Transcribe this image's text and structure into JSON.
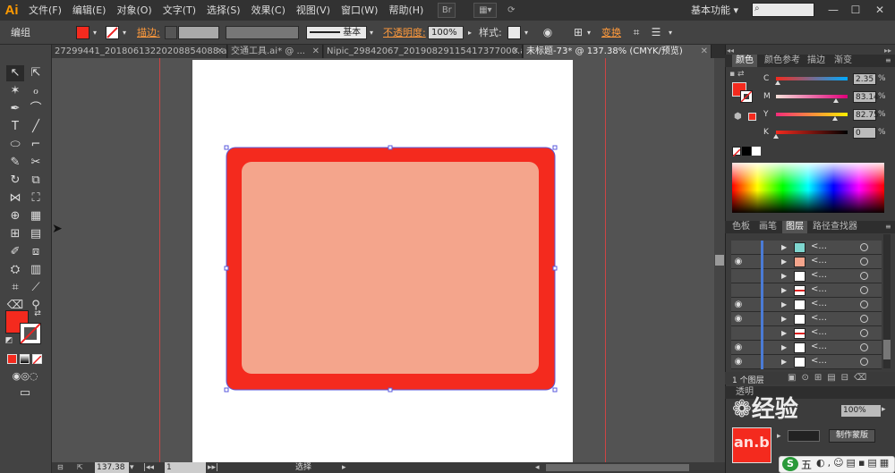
{
  "app": {
    "logo": "Ai"
  },
  "menu": [
    "文件(F)",
    "编辑(E)",
    "对象(O)",
    "文字(T)",
    "选择(S)",
    "效果(C)",
    "视图(V)",
    "窗口(W)",
    "帮助(H)"
  ],
  "header": {
    "workspace": "基本功能",
    "workspace_arrow": "▾",
    "window_min": "—",
    "window_max": "☐",
    "window_close": "✕"
  },
  "control": {
    "mode": "编组",
    "stroke_label": "描边:",
    "stroke_style": "基本",
    "opacity_label": "不透明度:",
    "opacity_value": "100%",
    "style_label": "样式:",
    "transform_label": "变换",
    "fill_color": "#f42a1e"
  },
  "tabs": [
    {
      "label": "27299441_20180613220208854088.ai*",
      "close": "✕"
    },
    {
      "label": "交通工具.ai* @ ...",
      "close": "✕"
    },
    {
      "label": "Nipic_29842067_20190829115417377000.ai*",
      "close": "✕"
    },
    {
      "label": "未标题-73* @ 137.38% (CMYK/预览)",
      "close": "✕"
    }
  ],
  "artwork": {
    "outer_color": "#f42a1e",
    "inner_color": "#f4a58c"
  },
  "color_panel": {
    "tabs": [
      "颜色",
      "颜色参考",
      "描边",
      "渐变"
    ],
    "channels": [
      {
        "name": "C",
        "value": "2.35",
        "level": 0.0235
      },
      {
        "name": "M",
        "value": "83.14",
        "level": 0.8314
      },
      {
        "name": "Y",
        "value": "82.75",
        "level": 0.8275
      },
      {
        "name": "K",
        "value": "0",
        "level": 0
      }
    ],
    "unit": "%"
  },
  "layers_panel": {
    "tabs": [
      "色板",
      "画笔",
      "图层",
      "路径查找器"
    ],
    "rows": [
      {
        "eye": false,
        "thumb": "#7fd6cf",
        "name": "<...",
        "stripe": ""
      },
      {
        "eye": true,
        "thumb": "#f4a58c",
        "name": "<...",
        "stripe": ""
      },
      {
        "eye": false,
        "thumb": "#ffffff",
        "name": "<...",
        "stripe": ""
      },
      {
        "eye": false,
        "thumb": "#ffffff",
        "name": "<...",
        "stripe": "#d22"
      },
      {
        "eye": true,
        "thumb": "#ffffff",
        "name": "<...",
        "stripe": ""
      },
      {
        "eye": true,
        "thumb": "#ffffff",
        "name": "<...",
        "stripe": ""
      },
      {
        "eye": false,
        "thumb": "#ffffff",
        "name": "<...",
        "stripe": "#d22"
      },
      {
        "eye": true,
        "thumb": "#ffffff",
        "name": "<...",
        "stripe": ""
      },
      {
        "eye": true,
        "thumb": "#ffffff",
        "name": "<...",
        "stripe": ""
      }
    ],
    "count": "1 个图层"
  },
  "lower_panel": {
    "opacity_value": "100%",
    "mask_button": "制作蒙版",
    "tab_label": "透明"
  },
  "status": {
    "zoom": "137.38",
    "page": "1",
    "tool": "选择"
  },
  "watermark": {
    "text": "经验",
    "site": "an.b"
  },
  "ime": {
    "label": "五"
  }
}
